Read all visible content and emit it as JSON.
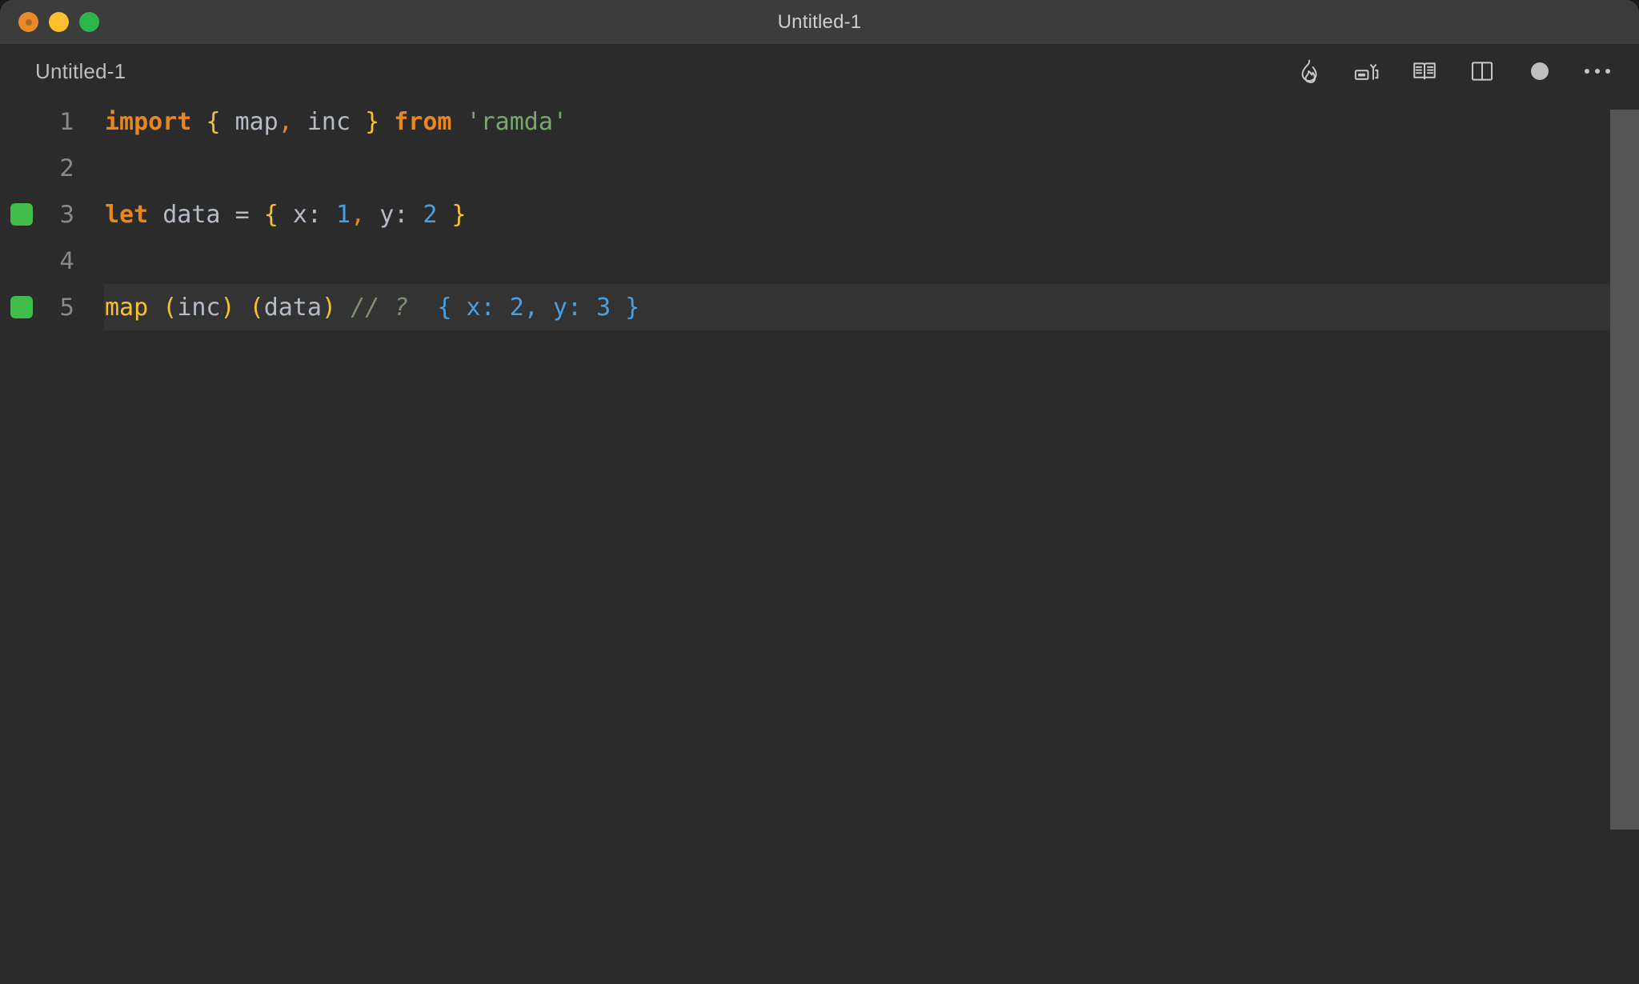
{
  "window": {
    "title": "Untitled-1",
    "traffic_lights": [
      {
        "name": "close",
        "color": "#e8892b"
      },
      {
        "name": "minimize",
        "color": "#fcc02e"
      },
      {
        "name": "maximize",
        "color": "#2eb648"
      }
    ]
  },
  "tab": {
    "label": "Untitled-1"
  },
  "toolbar": {
    "items": [
      {
        "icon": "flame-icon",
        "label": "Run Quokka"
      },
      {
        "icon": "rename-symbol-icon",
        "label": "Rename Symbol"
      },
      {
        "icon": "open-book-icon",
        "label": "Open Preview"
      },
      {
        "icon": "split-editor-icon",
        "label": "Split Editor"
      },
      {
        "icon": "record-dot-icon",
        "label": "Unsaved Changes"
      },
      {
        "icon": "ellipsis-icon",
        "label": "More Actions"
      }
    ]
  },
  "editor": {
    "language": "javascript",
    "lines": [
      {
        "number": "1",
        "marker": false,
        "highlight": false,
        "tokens": [
          {
            "text": "import",
            "type": "kw"
          },
          {
            "text": " ",
            "type": "punct"
          },
          {
            "text": "{",
            "type": "brace"
          },
          {
            "text": " ",
            "type": "punct"
          },
          {
            "text": "map",
            "type": "ident"
          },
          {
            "text": ",",
            "type": "comma"
          },
          {
            "text": " ",
            "type": "punct"
          },
          {
            "text": "inc",
            "type": "ident"
          },
          {
            "text": " ",
            "type": "punct"
          },
          {
            "text": "}",
            "type": "brace"
          },
          {
            "text": " ",
            "type": "punct"
          },
          {
            "text": "from",
            "type": "kw"
          },
          {
            "text": " ",
            "type": "punct"
          },
          {
            "text": "'ramda'",
            "type": "str"
          }
        ]
      },
      {
        "number": "2",
        "marker": false,
        "highlight": false,
        "tokens": []
      },
      {
        "number": "3",
        "marker": true,
        "highlight": false,
        "tokens": [
          {
            "text": "let",
            "type": "kw"
          },
          {
            "text": " ",
            "type": "punct"
          },
          {
            "text": "data",
            "type": "ident"
          },
          {
            "text": " ",
            "type": "punct"
          },
          {
            "text": "=",
            "type": "op"
          },
          {
            "text": " ",
            "type": "punct"
          },
          {
            "text": "{",
            "type": "brace"
          },
          {
            "text": " ",
            "type": "punct"
          },
          {
            "text": "x:",
            "type": "ident"
          },
          {
            "text": " ",
            "type": "punct"
          },
          {
            "text": "1",
            "type": "num"
          },
          {
            "text": ",",
            "type": "comma"
          },
          {
            "text": " ",
            "type": "punct"
          },
          {
            "text": "y:",
            "type": "ident"
          },
          {
            "text": " ",
            "type": "punct"
          },
          {
            "text": "2",
            "type": "num"
          },
          {
            "text": " ",
            "type": "punct"
          },
          {
            "text": "}",
            "type": "brace"
          }
        ]
      },
      {
        "number": "4",
        "marker": false,
        "highlight": false,
        "tokens": []
      },
      {
        "number": "5",
        "marker": true,
        "highlight": true,
        "tokens": [
          {
            "text": "map",
            "type": "fn"
          },
          {
            "text": " ",
            "type": "punct"
          },
          {
            "text": "(",
            "type": "fn"
          },
          {
            "text": "inc",
            "type": "ident"
          },
          {
            "text": ")",
            "type": "fn"
          },
          {
            "text": " ",
            "type": "punct"
          },
          {
            "text": "(",
            "type": "fn"
          },
          {
            "text": "data",
            "type": "ident"
          },
          {
            "text": ")",
            "type": "fn"
          },
          {
            "text": " ",
            "type": "punct"
          },
          {
            "text": "// ?",
            "type": "comment"
          },
          {
            "text": "  ",
            "type": "punct"
          },
          {
            "text": "{ x: 2, y: 3 }",
            "type": "result"
          }
        ]
      }
    ]
  },
  "scrollbar": {
    "visible": true
  },
  "colors": {
    "background": "#2b2b2b",
    "titlebar": "#3c3c3c",
    "line_highlight": "#333333",
    "marker_green": "#3fbd48",
    "keyword_orange": "#e8861f",
    "brace_yellow": "#f9c22c",
    "string_green": "#77a96b",
    "number_blue": "#4a9fe0",
    "identifier_gray": "#b6bcc6",
    "comment_green": "#7f8f72",
    "scrollbar_thumb": "#555555"
  }
}
